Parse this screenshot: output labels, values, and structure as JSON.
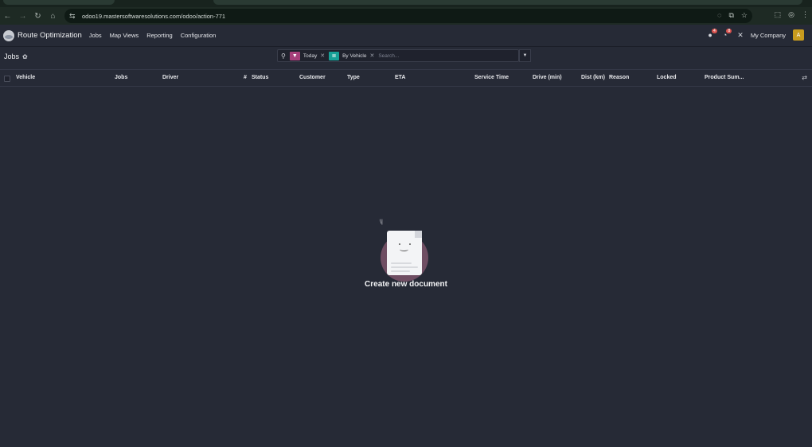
{
  "browser": {
    "url": "odoo19.mastersoftwaresolutions.com/odoo/action-771"
  },
  "navbar": {
    "app_name": "Route Optimization",
    "menu": [
      "Jobs",
      "Map Views",
      "Reporting",
      "Configuration"
    ],
    "messages_badge": "4",
    "activities_badge": "8",
    "company": "My Company",
    "avatar_letter": "A"
  },
  "control_panel": {
    "breadcrumb": "Jobs",
    "facets": [
      {
        "label": "Today",
        "icon": "filter-icon",
        "color": "#a63f7a"
      },
      {
        "label": "By Vehicle",
        "icon": "group-by-icon",
        "color": "#17a096"
      }
    ],
    "search_placeholder": "Search..."
  },
  "list": {
    "columns": [
      "Vehicle",
      "Jobs",
      "Driver",
      "#",
      "Status",
      "Customer",
      "Type",
      "ETA",
      "Service Time",
      "Drive (min)",
      "Dist (km)",
      "Reason",
      "Locked",
      "Product Sum..."
    ]
  },
  "empty_state": {
    "title": "Create new document"
  }
}
